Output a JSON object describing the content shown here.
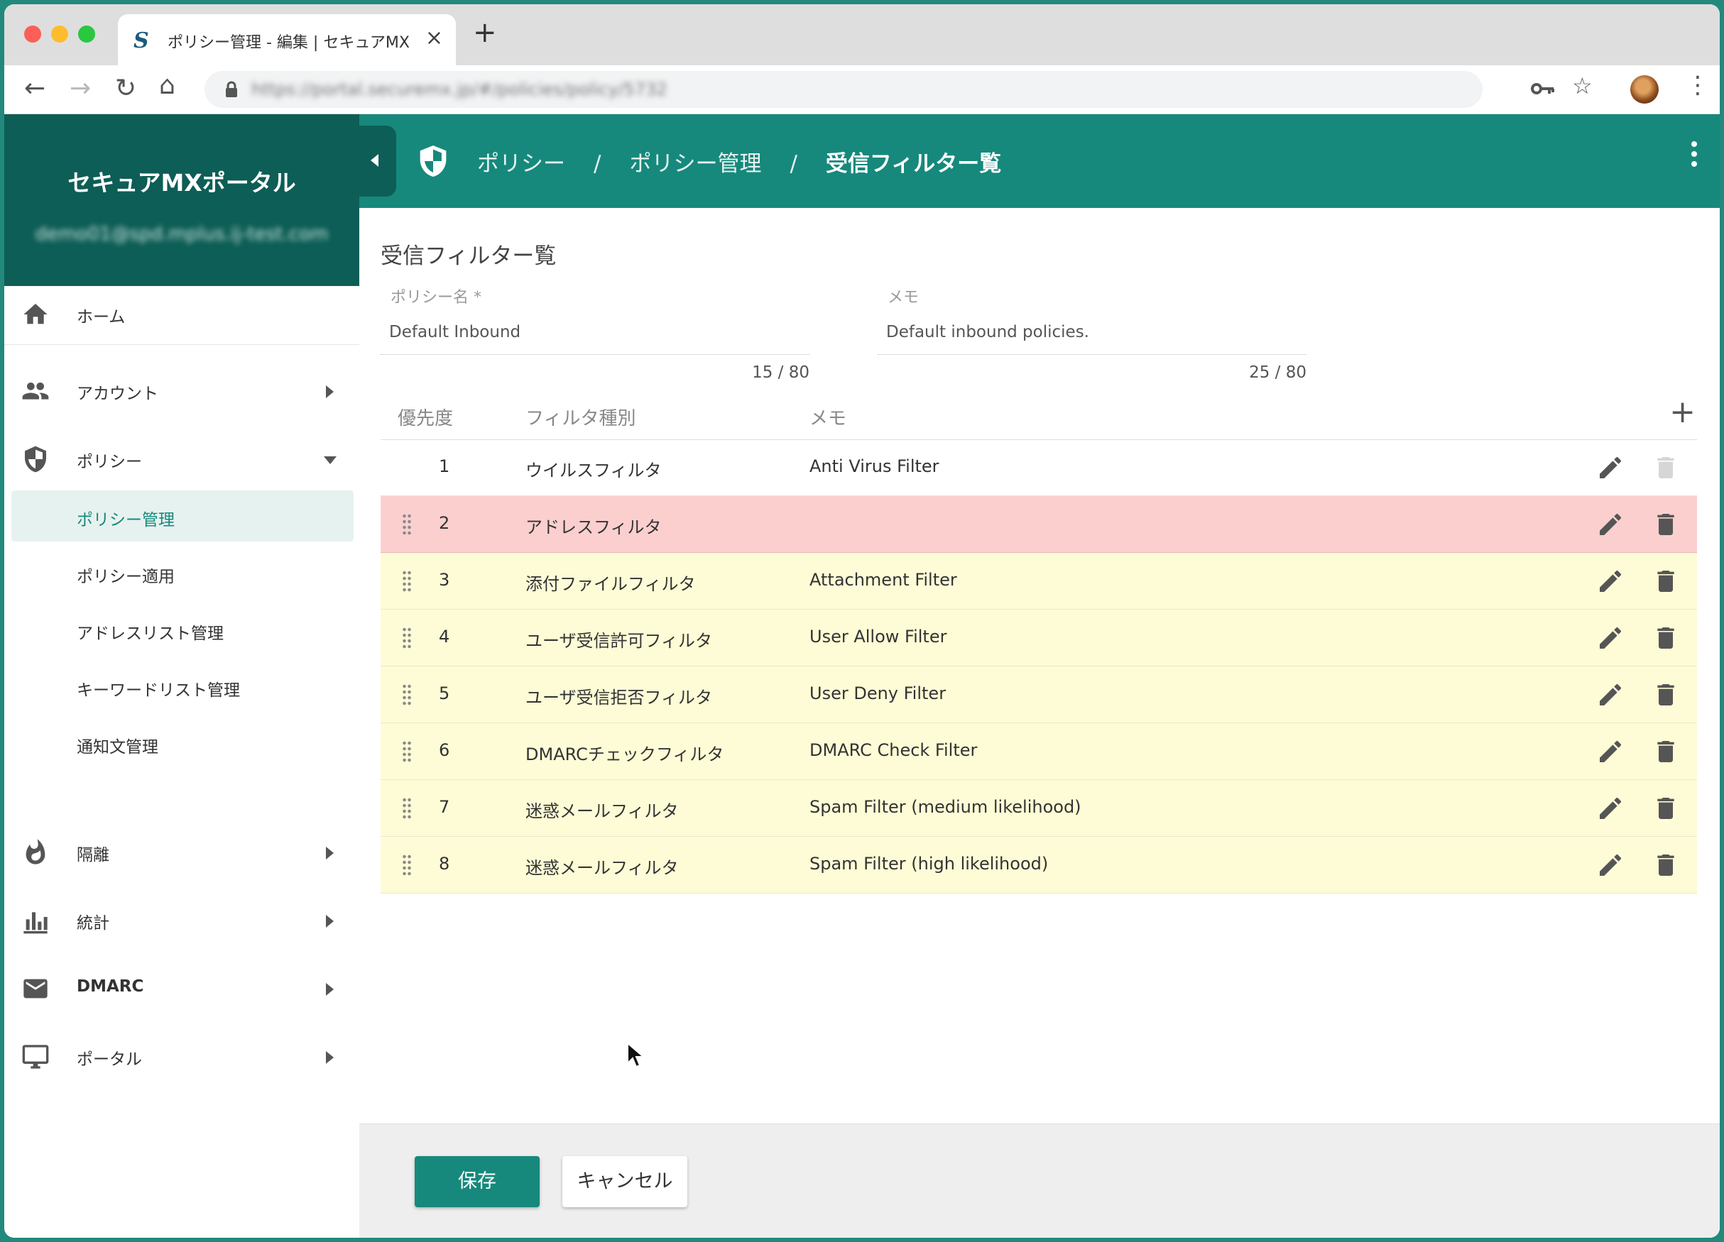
{
  "browser": {
    "tab_title": "ポリシー管理 - 編集 | セキュアMX",
    "url": "https://portal.securemx.jp/#/policies/policy/5732",
    "favicon_letter": "S"
  },
  "sidebar": {
    "app_title": "セキュアMXポータル",
    "user_email": "demo01@spd.mplus.ij-test.com",
    "items": [
      {
        "label": "ホーム",
        "icon": "home-icon"
      },
      {
        "label": "アカウント",
        "icon": "people-icon"
      },
      {
        "label": "ポリシー",
        "icon": "shield-icon"
      },
      {
        "label": "隔離",
        "icon": "fire-icon"
      },
      {
        "label": "統計",
        "icon": "bar-chart-icon"
      },
      {
        "label": "DMARC",
        "icon": "mail-icon"
      },
      {
        "label": "ポータル",
        "icon": "monitor-icon"
      }
    ],
    "policy_subitems": [
      "ポリシー管理",
      "ポリシー適用",
      "アドレスリスト管理",
      "キーワードリスト管理",
      "通知文管理"
    ]
  },
  "header": {
    "breadcrumb": [
      "ポリシー",
      "ポリシー管理",
      "受信フィルター覧"
    ],
    "separator": "/"
  },
  "form": {
    "section_title": "受信フィルター覧",
    "policy_name": {
      "label": "ポリシー名 *",
      "value": "Default Inbound",
      "counter": "15 / 80"
    },
    "memo": {
      "label": "メモ",
      "value": "Default inbound policies.",
      "counter": "25 / 80"
    }
  },
  "table": {
    "headers": {
      "priority": "優先度",
      "type": "フィルタ種別",
      "memo": "メモ"
    },
    "rows": [
      {
        "priority": "1",
        "type": "ウイルスフィルタ",
        "memo": "Anti Virus Filter"
      },
      {
        "priority": "2",
        "type": "アドレスフィルタ",
        "memo": ""
      },
      {
        "priority": "3",
        "type": "添付ファイルフィルタ",
        "memo": "Attachment Filter"
      },
      {
        "priority": "4",
        "type": "ユーザ受信許可フィルタ",
        "memo": "User Allow Filter"
      },
      {
        "priority": "5",
        "type": "ユーザ受信拒否フィルタ",
        "memo": "User Deny Filter"
      },
      {
        "priority": "6",
        "type": "DMARCチェックフィルタ",
        "memo": "DMARC Check Filter"
      },
      {
        "priority": "7",
        "type": "迷惑メールフィルタ",
        "memo": "Spam Filter (medium likelihood)"
      },
      {
        "priority": "8",
        "type": "迷惑メールフィルタ",
        "memo": "Spam Filter (high likelihood)"
      }
    ]
  },
  "footer": {
    "save_label": "保存",
    "cancel_label": "キャンセル"
  },
  "colors": {
    "primary": "#16897c",
    "primary_dark": "#0d5e56",
    "row_highlight_red": "#fccfcf",
    "row_highlight_yellow": "#fdfcd6"
  }
}
